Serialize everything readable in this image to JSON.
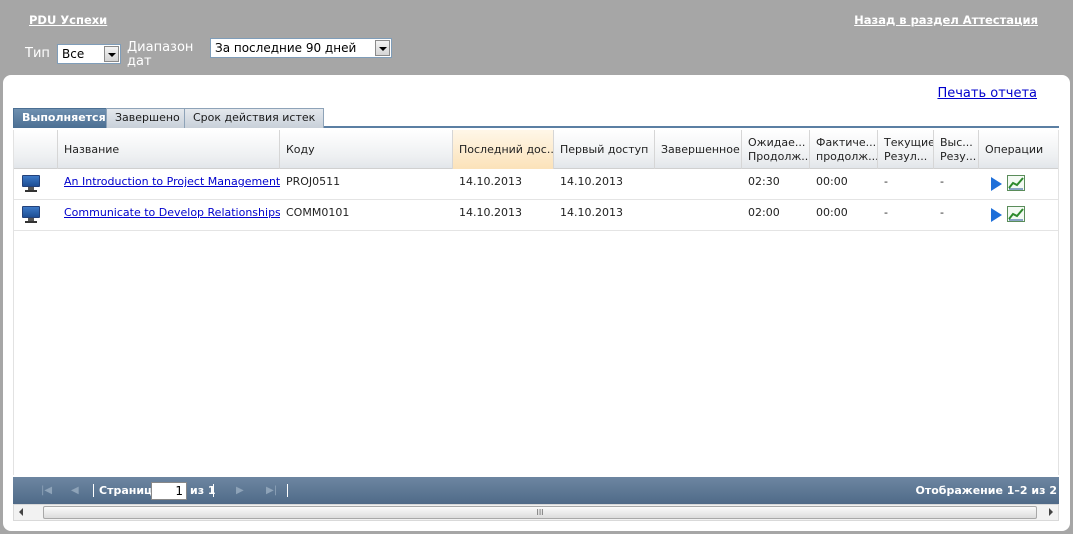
{
  "header": {
    "title_link": "PDU Успехи",
    "back_link": "Назад в раздел Аттестация"
  },
  "filters": {
    "type_label": "Тип",
    "type_value": "Все",
    "date_range_label_line1": "Диапазон",
    "date_range_label_line2": "дат",
    "date_range_value": "За последние 90 дней"
  },
  "report": {
    "print_link": "Печать отчета"
  },
  "tabs": [
    {
      "label": "Выполняется",
      "active": true
    },
    {
      "label": "Завершено",
      "active": false
    },
    {
      "label": "Срок действия истек",
      "active": false
    }
  ],
  "columns": {
    "name": "Название",
    "code": "Коду",
    "last_access": "Последний дос...",
    "first_access": "Первый доступ",
    "completed": "Завершенное",
    "expected_1": "Ожидае...",
    "expected_2": "Продолж...",
    "actual_1": "Фактиче...",
    "actual_2": "продолж...",
    "current_1": "Текущие",
    "current_2": "Резул...",
    "high_1": "Выс...",
    "high_2": "Резу...",
    "operations": "Операции"
  },
  "rows": [
    {
      "name": "An Introduction to Project Management",
      "code": "PROJ0511",
      "last_access": "14.10.2013",
      "first_access": "14.10.2013",
      "completed": "",
      "expected": "02:30",
      "actual": "00:00",
      "current": "-",
      "high": "-"
    },
    {
      "name": "Communicate to Develop Relationships",
      "code": "COMM0101",
      "last_access": "14.10.2013",
      "first_access": "14.10.2013",
      "completed": "",
      "expected": "02:00",
      "actual": "00:00",
      "current": "-",
      "high": "-"
    }
  ],
  "pager": {
    "page_label": "Страница",
    "page_value": "1",
    "of_label": "из 1",
    "display_text": "Отображение 1–2 из 2"
  },
  "scrollbar": {
    "grip": "III"
  },
  "colors": {
    "page_bg": "#a6a6a6",
    "active_tab": "#4b6f93",
    "pager_bg": "#5b7693",
    "link": "#0000cc",
    "sorted_column": "#fbe2b9"
  },
  "icons": [
    "course-monitor-icon",
    "play-icon",
    "chart-icon"
  ]
}
